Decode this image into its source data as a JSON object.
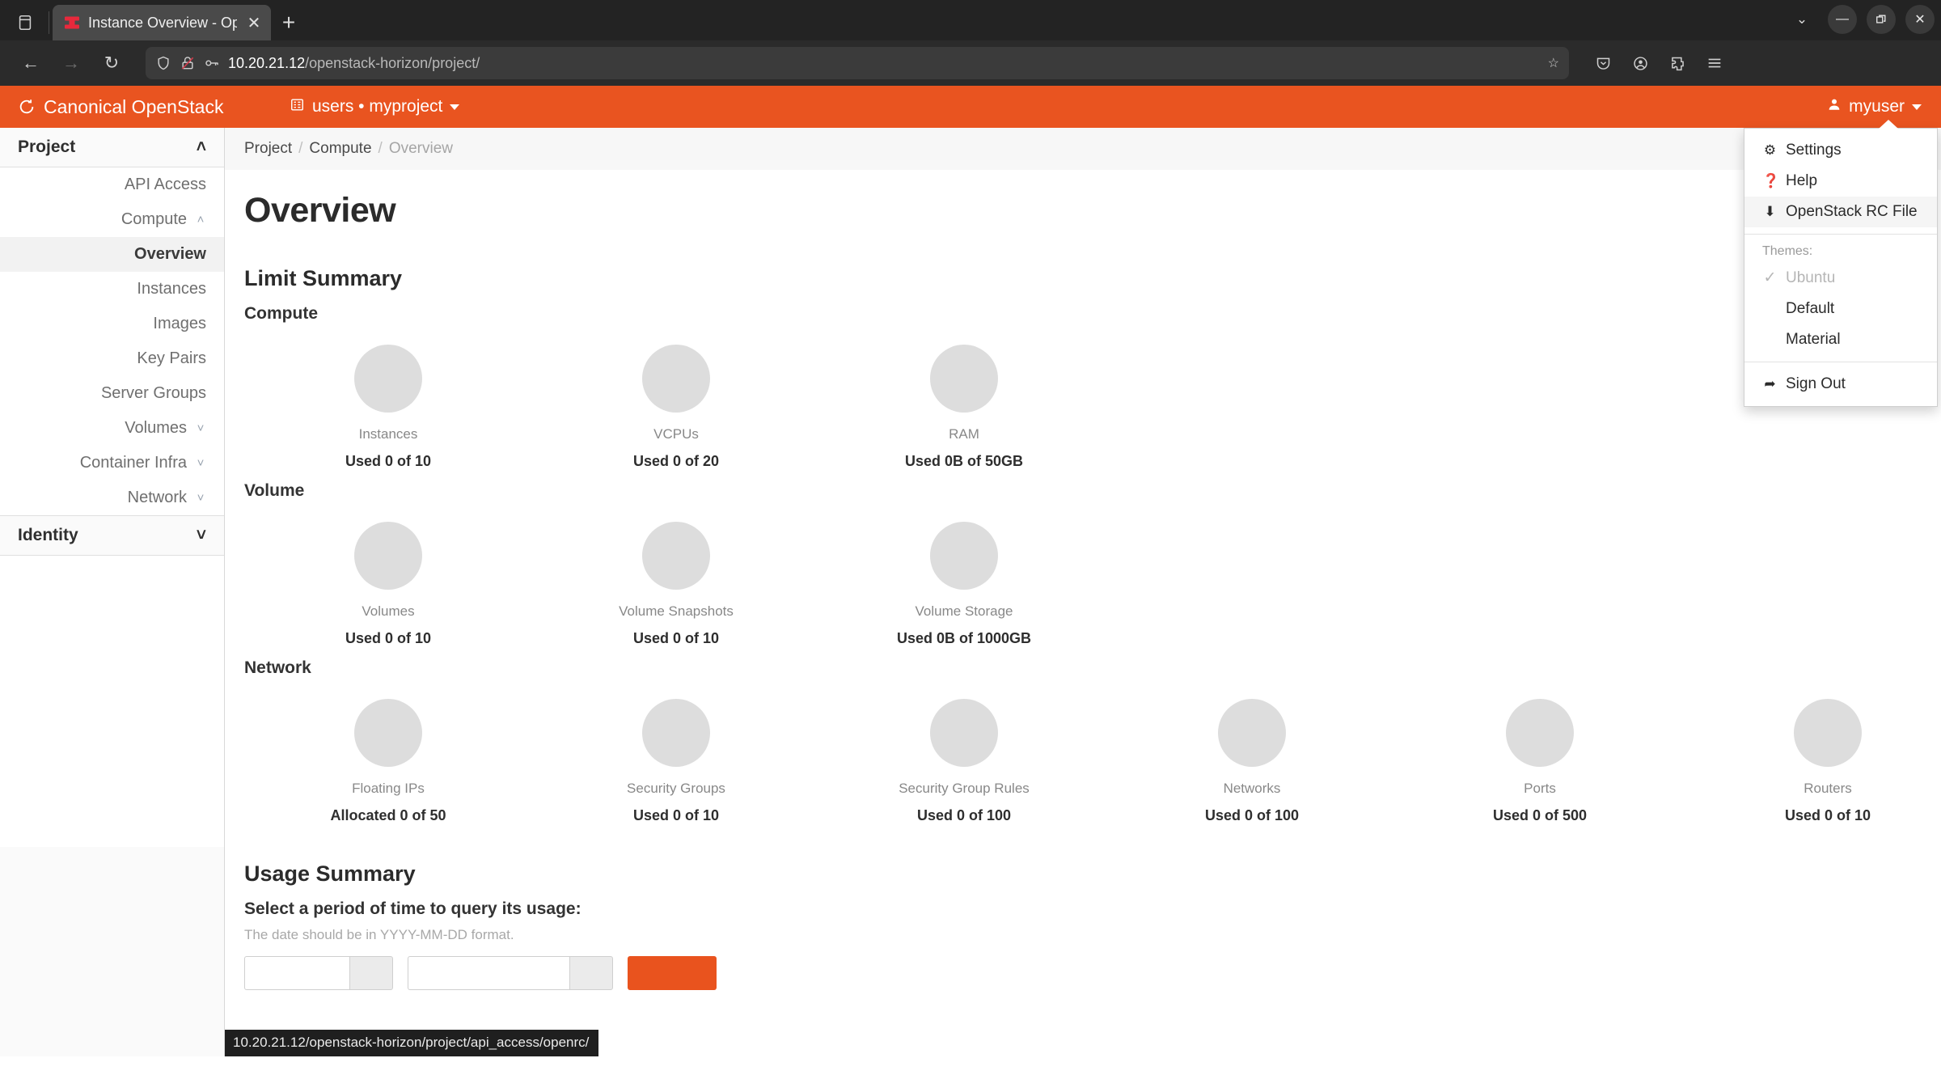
{
  "browser": {
    "tab": {
      "title": "Instance Overview - Open",
      "favicon": "openstack-favicon",
      "close": "✕"
    },
    "new_tab": "+",
    "firefox_view_icon": "firefox-view-icon",
    "tab_list_chevron": "⌄",
    "window_controls": {
      "minimize": "—",
      "maximize": "❐",
      "close": "✕"
    },
    "nav": {
      "back": "←",
      "forward": "→",
      "reload": "↻"
    },
    "url": {
      "host": "10.20.21.12",
      "path": "/openstack-horizon/project/"
    },
    "url_icons": {
      "shield": "shield-icon",
      "lock_broken": "lock-broken-icon",
      "key": "key-icon",
      "star": "☆"
    },
    "toolbar_right": [
      "pocket-icon",
      "account-icon",
      "extensions-icon",
      "app-menu-icon"
    ]
  },
  "topbar": {
    "brand": "Canonical OpenStack",
    "brand_logo": "openstack-logo",
    "project_switcher": {
      "icon": "grid-icon",
      "label": "users • myproject"
    },
    "user": {
      "icon": "user-icon",
      "label": "myuser"
    }
  },
  "user_dropdown": {
    "items": [
      {
        "icon": "⚙",
        "label": "Settings",
        "hover": false
      },
      {
        "icon": "❓",
        "label": "Help",
        "hover": false
      },
      {
        "icon": "⬇",
        "label": "OpenStack RC File",
        "hover": true
      }
    ],
    "themes_label": "Themes:",
    "themes": [
      {
        "label": "Ubuntu",
        "checked": true
      },
      {
        "label": "Default",
        "checked": false
      },
      {
        "label": "Material",
        "checked": false
      }
    ],
    "sign_out": {
      "icon": "➦",
      "label": "Sign Out"
    }
  },
  "sidebar": {
    "groups": [
      {
        "label": "Project",
        "expanded": true,
        "chevron": "˄"
      },
      {
        "label": "Identity",
        "expanded": false,
        "chevron": "˅"
      }
    ],
    "items": [
      {
        "label": "API Access",
        "chevron": "",
        "active": false
      },
      {
        "label": "Compute",
        "chevron": "˄",
        "active": false
      },
      {
        "label": "Overview",
        "chevron": "",
        "active": true
      },
      {
        "label": "Instances",
        "chevron": "",
        "active": false
      },
      {
        "label": "Images",
        "chevron": "",
        "active": false
      },
      {
        "label": "Key Pairs",
        "chevron": "",
        "active": false
      },
      {
        "label": "Server Groups",
        "chevron": "",
        "active": false
      },
      {
        "label": "Volumes",
        "chevron": "˅",
        "active": false
      },
      {
        "label": "Container Infra",
        "chevron": "˅",
        "active": false
      },
      {
        "label": "Network",
        "chevron": "˅",
        "active": false
      }
    ]
  },
  "breadcrumb": {
    "items": [
      "Project",
      "Compute",
      "Overview"
    ],
    "separator": "/"
  },
  "page": {
    "title": "Overview"
  },
  "limit_summary": {
    "title": "Limit Summary",
    "sections": [
      {
        "name": "Compute",
        "items": [
          {
            "label": "Instances",
            "value": "Used 0 of 10"
          },
          {
            "label": "VCPUs",
            "value": "Used 0 of 20"
          },
          {
            "label": "RAM",
            "value": "Used 0B of 50GB"
          }
        ]
      },
      {
        "name": "Volume",
        "items": [
          {
            "label": "Volumes",
            "value": "Used 0 of 10"
          },
          {
            "label": "Volume Snapshots",
            "value": "Used 0 of 10"
          },
          {
            "label": "Volume Storage",
            "value": "Used 0B of 1000GB"
          }
        ]
      },
      {
        "name": "Network",
        "items": [
          {
            "label": "Floating IPs",
            "value": "Allocated 0 of 50"
          },
          {
            "label": "Security Groups",
            "value": "Used 0 of 10"
          },
          {
            "label": "Security Group Rules",
            "value": "Used 0 of 100"
          },
          {
            "label": "Networks",
            "value": "Used 0 of 100"
          },
          {
            "label": "Ports",
            "value": "Used 0 of 500"
          },
          {
            "label": "Routers",
            "value": "Used 0 of 10"
          }
        ]
      }
    ]
  },
  "usage_summary": {
    "title": "Usage Summary",
    "prompt": "Select a period of time to query its usage:",
    "hint": "The date should be in YYYY-MM-DD format."
  },
  "status_bar": {
    "url": "10.20.21.12/openstack-horizon/project/api_access/openrc/"
  },
  "colors": {
    "brand_orange": "#E95420",
    "donut_gray": "#dddddd",
    "favicon_red": "#E8293C"
  }
}
